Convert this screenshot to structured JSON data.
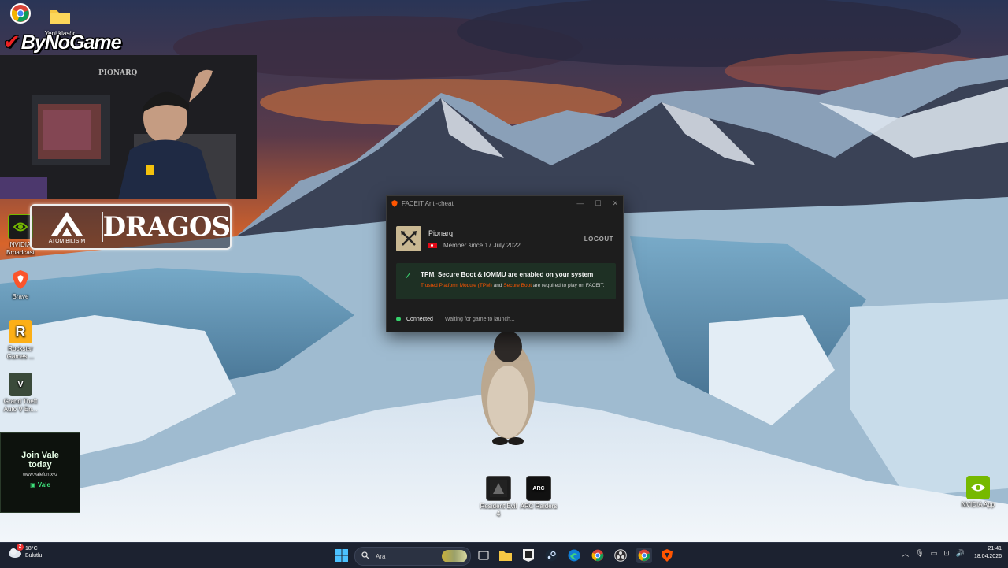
{
  "desktop_icons": [
    {
      "label": "",
      "icon": "chrome-icon"
    },
    {
      "label": "Yeni klasör",
      "icon": "folder-icon"
    },
    {
      "label": "NVIDIA Broadcast",
      "icon": "nvidia-broadcast-icon"
    },
    {
      "label": "Brave",
      "icon": "brave-icon"
    },
    {
      "label": "Rockstar Games ...",
      "icon": "rockstar-icon"
    },
    {
      "label": "Grand Theft Auto V En...",
      "icon": "gta-icon"
    },
    {
      "label": "Resident Evil 4",
      "icon": "resident-evil-icon"
    },
    {
      "label": "ARC Raiders",
      "icon": "arc-raiders-icon"
    },
    {
      "label": "NVIDIA App",
      "icon": "nvidia-app-icon"
    }
  ],
  "overlay": {
    "brand": "ByNoGame",
    "sponsor_left_small": "ATOM BILISIM",
    "sponsor_right": "DRAGOS",
    "webcam_sign": "PIONARQ",
    "ad": {
      "headline_1": "Join Vale",
      "headline_2": "today",
      "url": "www.valefun.xyz",
      "button": "Vale"
    }
  },
  "faceit": {
    "title": "FACEIT Anti-cheat",
    "username": "Pionarq",
    "member_since": "Member since 17 July 2022",
    "logout": "LOGOUT",
    "status_title": "TPM, Secure Boot & IOMMU are enabled on your system",
    "status_link_1": "Trusted Platform Module (TPM)",
    "status_and": "and",
    "status_link_2": "Secure Boot",
    "status_tail": "are required to play on FACEIT.",
    "connection": "Connected",
    "waiting": "Waiting for game to launch...",
    "colors": {
      "accent": "#ff5500",
      "ok": "#36d36c"
    }
  },
  "taskbar": {
    "weather_temp": "18°C",
    "weather_desc": "Bulutlu",
    "weather_badge": "2",
    "search_placeholder": "Ara",
    "apps": [
      "start-icon",
      "search-icon",
      "task-view-icon",
      "file-explorer-icon",
      "epic-games-icon",
      "steam-icon",
      "edge-icon",
      "chrome-icon",
      "obs-icon",
      "chrome-active-icon",
      "faceit-icon"
    ],
    "time": "21:41",
    "date": "18.04.2026"
  }
}
